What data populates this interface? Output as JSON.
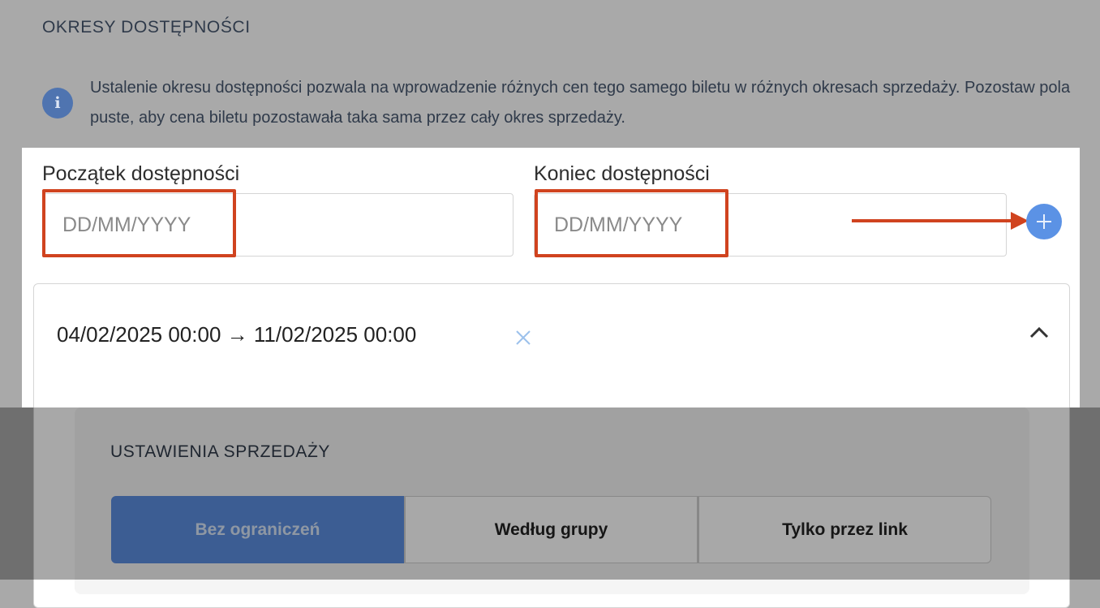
{
  "availability": {
    "section_title": "OKRESY DOSTĘPNOŚCI",
    "info_text": "Ustalenie okresu dostępności pozwala na wprowadzenie różnych cen tego samego biletu w różnych okresach sprzedaży. Pozostaw pola puste, aby cena biletu pozostawała taka sama przez cały okres sprzedaży.",
    "info_icon": "info-icon",
    "start_label": "Początek dostępności",
    "start_placeholder": "DD/MM/YYYY",
    "end_label": "Koniec dostępności",
    "end_placeholder": "DD/MM/YYYY",
    "add_icon": "plus-icon"
  },
  "period": {
    "range": "04/02/2025 00:00 → 11/02/2025 00:00",
    "remove_icon": "close-icon",
    "toggle_icon": "chevron-up-icon"
  },
  "sales_settings": {
    "title": "USTAWIENIA SPRZEDAŻY",
    "options": [
      "Bez ograniczeń",
      "Według grupy",
      "Tylko przez link"
    ],
    "selected": "Bez ograniczeń"
  },
  "colors": {
    "highlight": "#d0431f",
    "accent": "#5b92e5",
    "info": "#4f74b0"
  }
}
